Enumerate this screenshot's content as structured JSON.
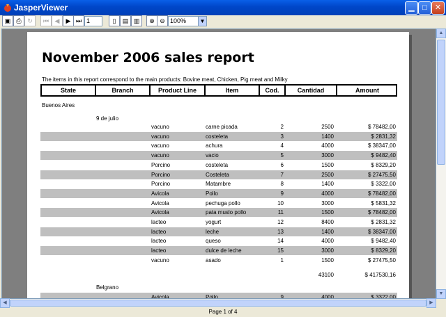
{
  "window": {
    "title": "JasperViewer"
  },
  "toolbar": {
    "page_value": "1",
    "zoom_value": "100%"
  },
  "status": {
    "page_text": "Page 1 of 4"
  },
  "report": {
    "title": "November 2006 sales report",
    "intro": "The items in this report correspond to the main  products: Bovine meat, Chicken, Pig meat and  Milky",
    "headers": [
      "State",
      "Branch",
      "Product Line",
      "Item",
      "Cod.",
      "Cantidad",
      "Amount"
    ],
    "state": "Buenos Aires",
    "branch1": "9 de julio",
    "rows": [
      {
        "line": "vacuno",
        "item": "carne picada",
        "cod": "2",
        "qty": "2500",
        "amount": "$ 78482,00"
      },
      {
        "line": "vacuno",
        "item": "costeleta",
        "cod": "3",
        "qty": "1400",
        "amount": "$ 2831,32"
      },
      {
        "line": "vacuno",
        "item": "achura",
        "cod": "4",
        "qty": "4000",
        "amount": "$ 38347,00"
      },
      {
        "line": "vacuno",
        "item": "vacio",
        "cod": "5",
        "qty": "3000",
        "amount": "$ 9482,40"
      },
      {
        "line": "Porcino",
        "item": "costeleta",
        "cod": "6",
        "qty": "1500",
        "amount": "$ 8329,20"
      },
      {
        "line": "Porcino",
        "item": "Costeleta",
        "cod": "7",
        "qty": "2500",
        "amount": "$ 27475,50"
      },
      {
        "line": "Porcino",
        "item": "Matambre",
        "cod": "8",
        "qty": "1400",
        "amount": "$ 3322,00"
      },
      {
        "line": "Avicola",
        "item": "Pollo",
        "cod": "9",
        "qty": "4000",
        "amount": "$ 78482,00"
      },
      {
        "line": "Avicola",
        "item": "pechuga pollo",
        "cod": "10",
        "qty": "3000",
        "amount": "$ 5831,32"
      },
      {
        "line": "Avicola",
        "item": "pata muslo pollo",
        "cod": "11",
        "qty": "1500",
        "amount": "$ 78482,00"
      },
      {
        "line": "lacteo",
        "item": "yogurt",
        "cod": "12",
        "qty": "8400",
        "amount": "$ 2831,32"
      },
      {
        "line": "lacteo",
        "item": "leche",
        "cod": "13",
        "qty": "1400",
        "amount": "$ 38347,00"
      },
      {
        "line": "lacteo",
        "item": "queso",
        "cod": "14",
        "qty": "4000",
        "amount": "$ 9482,40"
      },
      {
        "line": "lacteo",
        "item": "dulce de leche",
        "cod": "15",
        "qty": "3000",
        "amount": "$ 8329,20"
      },
      {
        "line": "vacuno",
        "item": "asado",
        "cod": "1",
        "qty": "1500",
        "amount": "$ 27475,50"
      }
    ],
    "total_qty": "43100",
    "total_amount": "$ 417530,16",
    "branch2": "Belgrano",
    "rows2": [
      {
        "line": "Avicola",
        "item": "Pollo",
        "cod": "9",
        "qty": "4000",
        "amount": "$ 3322,00"
      }
    ]
  }
}
